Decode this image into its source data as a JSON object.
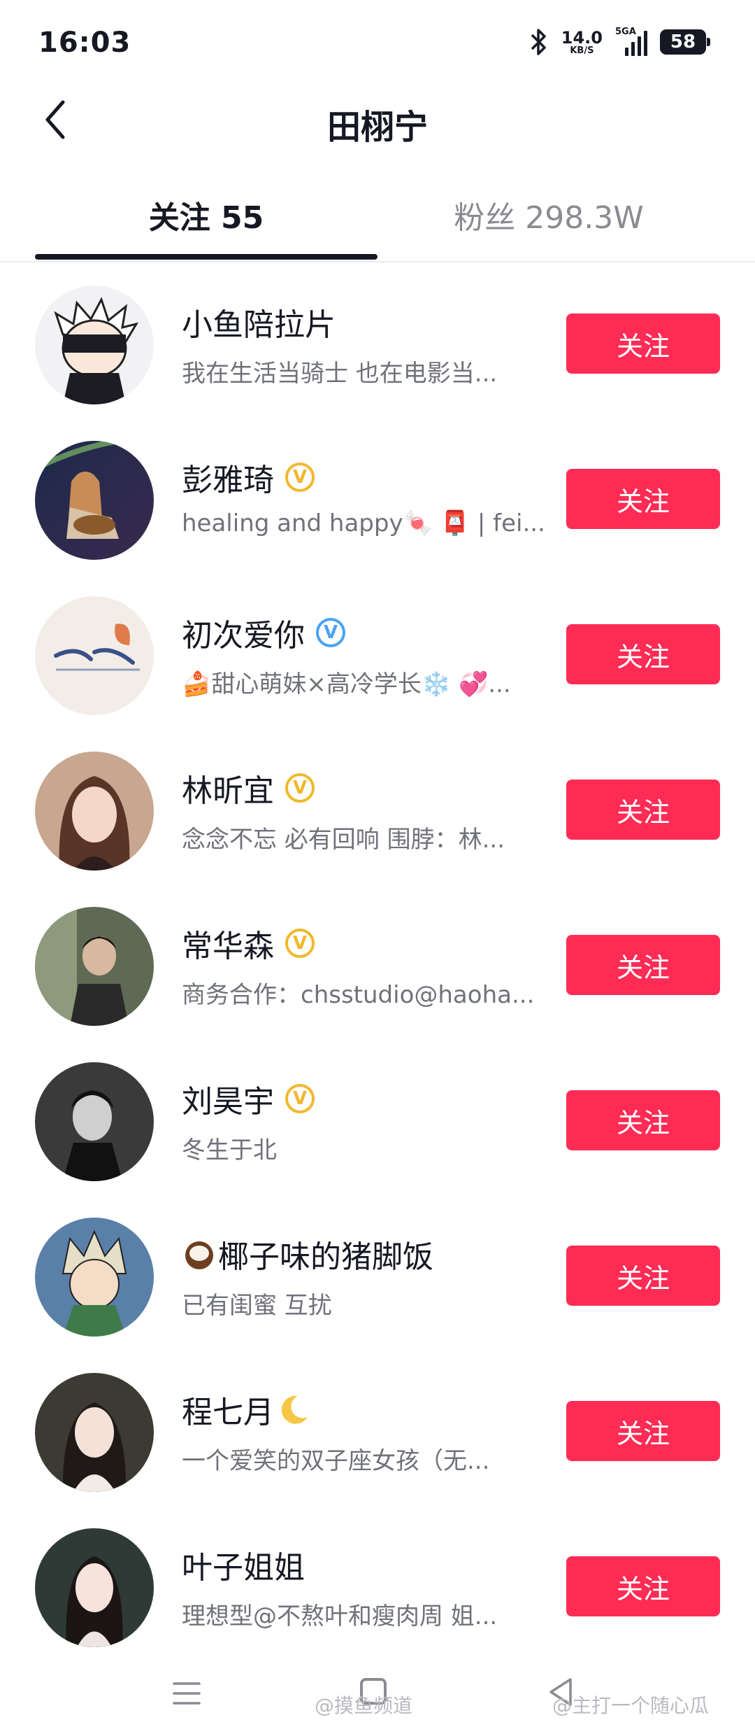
{
  "status_bar": {
    "time": "16:03",
    "net_speed_value": "14.0",
    "net_speed_unit": "KB/S",
    "network_type": "5GA",
    "battery": "58"
  },
  "header": {
    "title": "田栩宁",
    "back_icon": "chevron-left-icon"
  },
  "tabs": {
    "following": "关注 55",
    "followers": "粉丝 298.3W"
  },
  "colors": {
    "follow_button": "#fe2c55",
    "verified_gold": "#f1b82d",
    "verified_blue": "#4aa3f0"
  },
  "users": [
    {
      "name": "小鱼陪拉片",
      "bio": "我在生活当骑士 也在电影当...",
      "button": "关注",
      "verified": "none"
    },
    {
      "name": "彭雅琦",
      "bio": "healing and happy🍬 📮 | fei...",
      "button": "关注",
      "verified": "gold"
    },
    {
      "name": "初次爱你",
      "bio": "🍰甜心萌妹×高冷学长❄️ 💞...",
      "button": "关注",
      "verified": "blue"
    },
    {
      "name": "林昕宜",
      "bio": "念念不忘 必有回响 围脖：林...",
      "button": "关注",
      "verified": "gold"
    },
    {
      "name": "常华森",
      "bio": "商务合作：chsstudio@haoha...",
      "button": "关注",
      "verified": "gold"
    },
    {
      "name": "刘昊宇",
      "bio": "冬生于北",
      "button": "关注",
      "verified": "gold"
    },
    {
      "name": "椰子味的猪脚饭",
      "bio": "已有闺蜜 互扰",
      "button": "关注",
      "verified": "none",
      "prefix_icon": "coconut-icon"
    },
    {
      "name": "程七月",
      "bio": "一个爱笑的双子座女孩（无...",
      "button": "关注",
      "verified": "none",
      "suffix_icon": "crescent-moon-icon"
    },
    {
      "name": "叶子姐姐",
      "bio": "理想型@不熬叶和瘦肉周 姐...",
      "button": "关注",
      "verified": "none"
    }
  ],
  "watermarks": [
    "@摸鱼频道",
    "@主打一个随心瓜"
  ]
}
